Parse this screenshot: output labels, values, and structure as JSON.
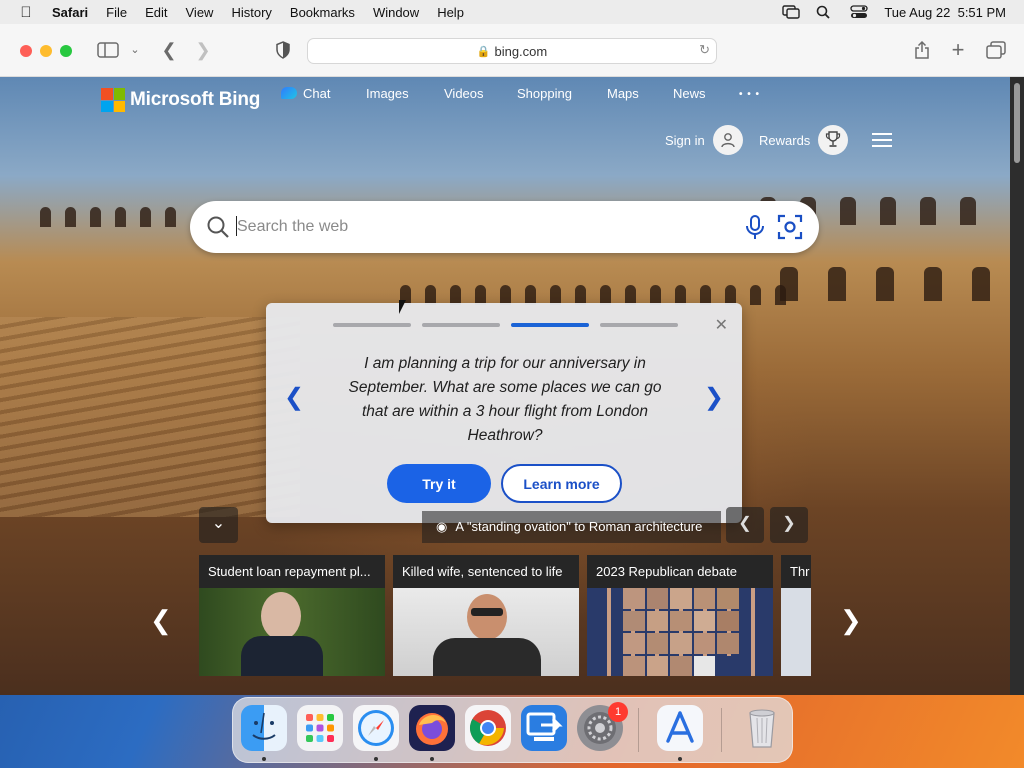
{
  "menubar": {
    "app_name": "Safari",
    "items": [
      "File",
      "Edit",
      "View",
      "History",
      "Bookmarks",
      "Window",
      "Help"
    ],
    "datetime": "Tue Aug 22  5:51 PM"
  },
  "browser": {
    "url": "bing.com"
  },
  "bing": {
    "logo_text": "Microsoft Bing",
    "nav": [
      "Chat",
      "Images",
      "Videos",
      "Shopping",
      "Maps",
      "News"
    ],
    "more_label": "• • •",
    "signin_label": "Sign in",
    "rewards_label": "Rewards",
    "search_placeholder": "Search the web"
  },
  "popup": {
    "prompt": "I am planning a trip for our anniversary in September. What are some places we can go that are within a 3 hour flight from London Heathrow?",
    "try_label": "Try it",
    "learn_label": "Learn more",
    "active_step": 3,
    "step_count": 4
  },
  "caption": {
    "text": "A \"standing ovation\" to Roman architecture"
  },
  "news_cards": [
    {
      "title": "Student loan repayment pl..."
    },
    {
      "title": "Killed wife, sentenced to life"
    },
    {
      "title": "2023 Republican debate"
    },
    {
      "title": "Thr"
    }
  ],
  "dock": {
    "apps": [
      "finder-icon",
      "launchpad-icon",
      "safari-icon",
      "firefox-icon",
      "chrome-icon",
      "remote-desktop-icon",
      "system-settings-icon",
      "xcode-instruments-icon",
      "trash-icon"
    ],
    "badge_count": "1"
  },
  "colors": {
    "bing_blue": "#1b63e6",
    "menubar_bg": "#ececec"
  }
}
